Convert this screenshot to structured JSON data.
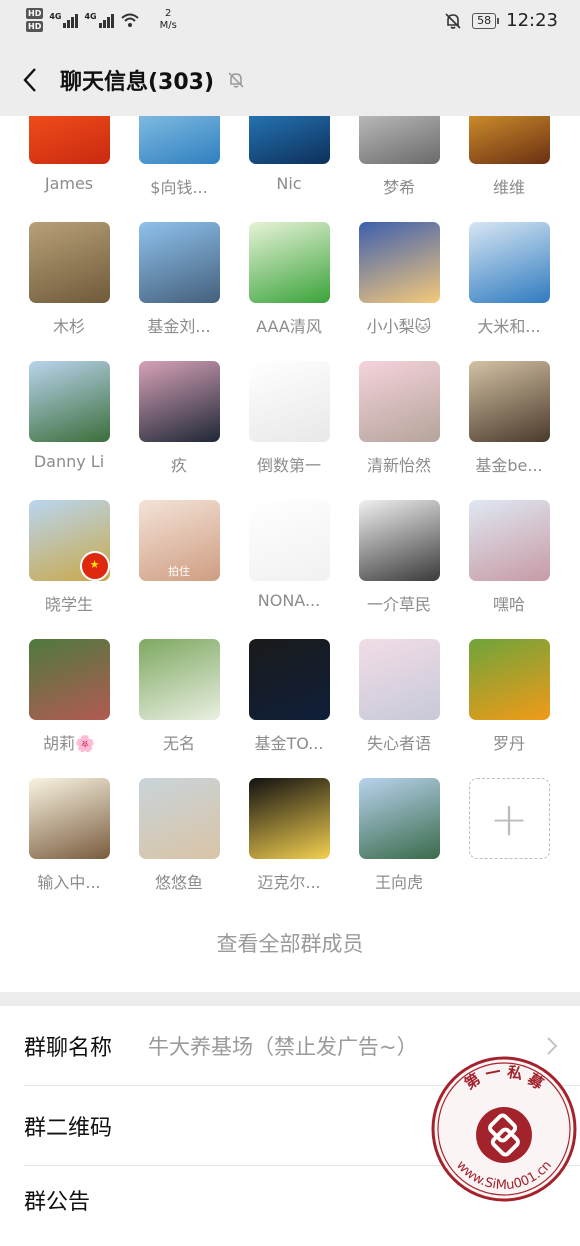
{
  "status_bar": {
    "speed_value": "2",
    "speed_unit": "M/s",
    "network_1": "4G",
    "network_2": "4G",
    "battery": "58",
    "time": "12:23"
  },
  "header": {
    "title": "聊天信息(303)"
  },
  "members": [
    {
      "name": "James",
      "colors": [
        "#ff5a1f",
        "#c92a10"
      ]
    },
    {
      "name": "$向钱...",
      "colors": [
        "#9fd3ee",
        "#2f7fc0"
      ]
    },
    {
      "name": "Nic",
      "colors": [
        "#2e8fd6",
        "#0d2f5a"
      ]
    },
    {
      "name": "梦希",
      "colors": [
        "#d9d9d9",
        "#6a6a6a"
      ]
    },
    {
      "name": "维维",
      "colors": [
        "#f3b235",
        "#6b2f12"
      ]
    },
    {
      "name": "木杉",
      "colors": [
        "#b8a178",
        "#6f5a3a"
      ]
    },
    {
      "name": "基金刘...",
      "colors": [
        "#8fc1ec",
        "#44607c"
      ]
    },
    {
      "name": "AAA清风",
      "colors": [
        "#e7f3d8",
        "#3aa33a"
      ]
    },
    {
      "name": "小小梨🐱",
      "colors": [
        "#3e5fae",
        "#f4c97b"
      ]
    },
    {
      "name": "大米和...",
      "colors": [
        "#d7e6f4",
        "#2f7bbf"
      ]
    },
    {
      "name": "Danny Li",
      "colors": [
        "#b9d4ee",
        "#3c6e3a"
      ]
    },
    {
      "name": "疚",
      "colors": [
        "#d7a2b8",
        "#1e2735"
      ]
    },
    {
      "name": "倒数第一",
      "colors": [
        "#ffffff",
        "#e8e8e8"
      ]
    },
    {
      "name": "清新怡然",
      "colors": [
        "#f5d3dc",
        "#b5a49a"
      ]
    },
    {
      "name": "基金be...",
      "colors": [
        "#d3c2a4",
        "#4a3a2c"
      ]
    },
    {
      "name": "晓学生",
      "colors": [
        "#b9d6f0",
        "#c9a84a"
      ]
    },
    {
      "name": "",
      "colors": [
        "#f3e3d8",
        "#cf9d81"
      ]
    },
    {
      "name": "NONA...",
      "colors": [
        "#ffffff",
        "#f1f1f1"
      ]
    },
    {
      "name": "一介草民",
      "colors": [
        "#f0f0f0",
        "#3a3a3a"
      ]
    },
    {
      "name": "嘿哈",
      "colors": [
        "#dfe8f2",
        "#c79aa5"
      ]
    },
    {
      "name": "胡莉🌸",
      "colors": [
        "#4e7a3f",
        "#b25a53"
      ]
    },
    {
      "name": "无名",
      "colors": [
        "#7ea860",
        "#e9efe2"
      ]
    },
    {
      "name": "基金TO...",
      "colors": [
        "#1a1a1a",
        "#0f1f3a"
      ]
    },
    {
      "name": "失心者语",
      "colors": [
        "#f2dde6",
        "#c7c9d9"
      ]
    },
    {
      "name": "罗丹",
      "colors": [
        "#6ea43c",
        "#f29a17"
      ]
    },
    {
      "name": "输入中...",
      "colors": [
        "#f9f4e2",
        "#7a5c3e"
      ]
    },
    {
      "name": "悠悠鱼",
      "colors": [
        "#c9d4da",
        "#d9c4a6"
      ]
    },
    {
      "name": "迈克尔...",
      "colors": [
        "#111111",
        "#f4d050"
      ]
    },
    {
      "name": "王向虎",
      "colors": [
        "#b8d3ee",
        "#3a6a4a"
      ]
    }
  ],
  "avatar_overlays": {
    "patted_caption": "拍住"
  },
  "view_all_label": "查看全部群成员",
  "settings": [
    {
      "label": "群聊名称",
      "value": "牛大养基场（禁止发广告~）"
    },
    {
      "label": "群二维码",
      "value": ""
    },
    {
      "label": "群公告",
      "value": ""
    }
  ],
  "watermark": {
    "text": "第 一 私 募",
    "url": "www.SiMu001.cn"
  },
  "colors": {
    "background": "#ededed",
    "secondary_text": "#8c8c8c",
    "stamp_red": "#a3232d"
  }
}
